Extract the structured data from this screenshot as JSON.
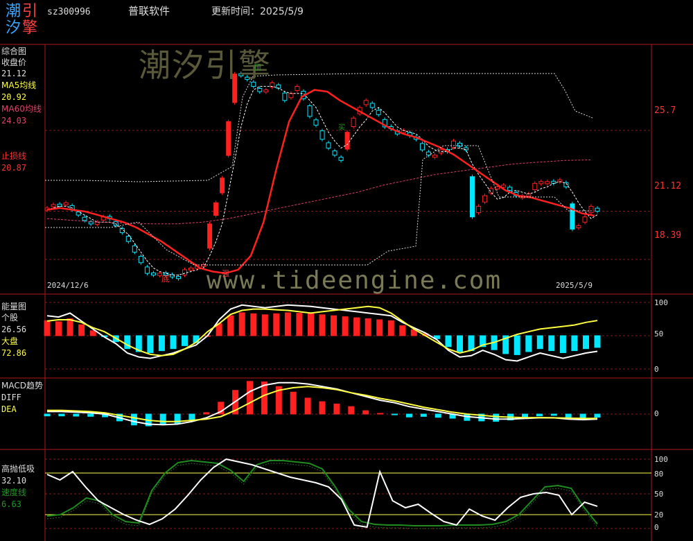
{
  "header": {
    "logo_chars": [
      "潮",
      "引",
      "汐",
      "擎"
    ],
    "code": "sz300996",
    "software": "普联软件",
    "update_label": "更新时间：2025/5/9"
  },
  "colors": {
    "up": "#ff2020",
    "down": "#00e8ff",
    "ma5": "#ffffff",
    "ma60": "#e0406a",
    "red_line": "#ff2020",
    "yellow": "#ffff40",
    "green": "#1e8c1e",
    "grid": "#a01010",
    "watermark": "#6a6a48"
  },
  "watermark": {
    "title": "潮汐引擎",
    "url": "www.tideengine.com"
  },
  "panels": {
    "main": {
      "title": "综合图",
      "close_label": "收盘价",
      "close_value": "21.12",
      "ma5_label": "MA5均线",
      "ma5_value": "20.92",
      "ma60_label": "MA60均线",
      "ma60_value": "24.03",
      "stop_label": "止损线",
      "stop_value": "20.87",
      "axis_labels": [
        "25.7",
        "21.12",
        "18.39"
      ],
      "date_start": "2024/12/6",
      "date_end": "2025/5/9",
      "annot_bottom": "底",
      "annot_strong": "强",
      "annot_top": "顶",
      "annot_buy": "买"
    },
    "energy": {
      "title": "能量图",
      "stock_label": "个股",
      "stock_value": "26.56",
      "market_label": "大盘",
      "market_value": "72.86",
      "axis_labels": [
        "100",
        "50",
        "0"
      ]
    },
    "macd": {
      "title": "MACD趋势",
      "diff_label": "DIFF",
      "dea_label": "DEA",
      "axis_labels": [
        "0"
      ]
    },
    "hilo": {
      "title": "高抛低吸",
      "value": "32.10",
      "speed_label": "速度线",
      "speed_value": "6.63",
      "axis_labels": [
        "100",
        "80",
        "50",
        "20",
        "0"
      ]
    }
  },
  "chart_data": [
    {
      "type": "candlestick",
      "title": "综合图",
      "x": [
        "2024/12/6",
        "2025/5/9"
      ],
      "ylim": [
        16.5,
        30.5
      ],
      "yticks": [
        25.7,
        21.12,
        18.39
      ],
      "series": [
        {
          "name": "收盘价",
          "values": [
            21.3,
            21.5,
            21.4,
            21.6,
            21.2,
            20.9,
            20.6,
            20.4,
            20.5,
            20.8,
            20.7,
            20.3,
            19.9,
            19.4,
            18.8,
            18.2,
            17.6,
            17.5,
            17.6,
            17.5,
            17.4,
            17.3,
            17.8,
            17.9,
            18.0,
            18.1,
            20.4,
            21.6,
            23.0,
            26.2,
            28.9,
            28.8,
            28.6,
            28.2,
            27.9,
            28.0,
            28.4,
            28.1,
            27.4,
            27.8,
            28.2,
            27.5,
            26.5,
            26.0,
            25.2,
            24.7,
            24.3,
            24.0,
            25.6,
            26.4,
            27.0,
            27.4,
            27.0,
            26.6,
            25.9,
            25.8,
            25.5,
            25.7,
            25.4,
            25.2,
            24.6,
            24.3,
            24.3,
            24.6,
            24.5,
            25.1,
            24.8,
            24.6,
            20.8,
            21.4,
            22.0,
            22.4,
            22.5,
            22.6,
            22.3,
            22.0,
            22.0,
            22.1,
            22.7,
            22.8,
            22.8,
            22.7,
            22.9,
            22.5,
            20.1,
            20.3,
            20.8,
            21.4,
            21.12
          ]
        },
        {
          "name": "MA5均线",
          "values": [
            21.2,
            21.3,
            21.4,
            21.4,
            21.3,
            21.1,
            20.9,
            20.7,
            20.5,
            20.5,
            20.5,
            20.4,
            20.1,
            19.8,
            19.3,
            18.8,
            18.3,
            17.9,
            17.7,
            17.6,
            17.5,
            17.5,
            17.6,
            17.7,
            17.8,
            17.9,
            18.6,
            19.4,
            20.4,
            22.2,
            24.0,
            25.9,
            27.2,
            28.0,
            28.2,
            28.2,
            28.2,
            28.1,
            27.9,
            27.8,
            27.8,
            27.8,
            27.4,
            27.0,
            26.3,
            25.6,
            25.1,
            24.7,
            24.9,
            25.4,
            25.9,
            26.3,
            26.8,
            27.0,
            26.7,
            26.3,
            25.9,
            25.7,
            25.6,
            25.5,
            25.2,
            24.8,
            24.6,
            24.5,
            24.5,
            24.7,
            24.7,
            24.6,
            23.8,
            23.2,
            22.7,
            22.2,
            21.8,
            21.9,
            22.2,
            22.3,
            22.2,
            22.1,
            22.2,
            22.4,
            22.5,
            22.7,
            22.8,
            22.7,
            22.2,
            21.6,
            21.1,
            20.7,
            20.92
          ]
        },
        {
          "name": "MA60均线",
          "values": [
            20.7,
            20.6,
            20.5,
            20.45,
            20.4,
            20.4,
            20.5,
            20.7,
            21.0,
            21.3,
            21.6,
            21.9,
            22.2,
            22.6,
            22.9,
            23.2,
            23.4,
            23.6,
            23.8,
            23.9,
            24.0,
            24.03
          ]
        },
        {
          "name": "止损线",
          "values": [
            21.2,
            21.3,
            21.2,
            21.1,
            20.9,
            20.7,
            20.5,
            20.2,
            19.8,
            19.4,
            18.9,
            18.4,
            17.9,
            17.7,
            17.6,
            17.8,
            18.6,
            20.5,
            23.5,
            26.2,
            27.6,
            28.0,
            27.9,
            27.4,
            27.0,
            26.6,
            26.2,
            25.8,
            25.5,
            25.3,
            25.0,
            24.7,
            24.3,
            23.8,
            23.3,
            22.8,
            22.3,
            22.0,
            21.9,
            21.7,
            21.5,
            21.3,
            21.0,
            20.87
          ]
        }
      ]
    },
    {
      "type": "bar",
      "title": "能量图",
      "ylim": [
        0,
        100
      ],
      "yticks": [
        100,
        50,
        0
      ],
      "series": [
        {
          "name": "个股",
          "values": [
            80,
            78,
            84,
            72,
            60,
            48,
            38,
            24,
            18,
            16,
            20,
            24,
            30,
            36,
            50,
            74,
            90,
            96,
            94,
            92,
            94,
            96,
            95,
            94,
            92,
            90,
            88,
            86,
            84,
            82,
            80,
            70,
            62,
            54,
            44,
            28,
            18,
            20,
            28,
            22,
            14,
            12,
            18,
            24,
            20,
            16,
            20,
            24,
            26.56
          ]
        },
        {
          "name": "大盘",
          "values": [
            72,
            74,
            74,
            70,
            62,
            56,
            46,
            36,
            28,
            22,
            20,
            22,
            30,
            40,
            56,
            68,
            82,
            88,
            90,
            90,
            89,
            88,
            86,
            84,
            86,
            88,
            90,
            92,
            94,
            92,
            84,
            72,
            60,
            50,
            40,
            30,
            24,
            28,
            36,
            40,
            46,
            52,
            56,
            60,
            62,
            64,
            66,
            70,
            72.86
          ]
        }
      ]
    },
    {
      "type": "line",
      "title": "MACD趋势",
      "series": [
        {
          "name": "DIFF",
          "values": [
            0.2,
            0.2,
            0.15,
            0.1,
            0.0,
            -0.3,
            -0.6,
            -0.8,
            -0.85,
            -0.8,
            -0.6,
            -0.3,
            0.2,
            1.0,
            1.8,
            2.3,
            2.5,
            2.5,
            2.4,
            2.2,
            2.0,
            1.7,
            1.4,
            1.1,
            0.9,
            0.6,
            0.4,
            0.2,
            0.0,
            -0.2,
            -0.3,
            -0.4,
            -0.4,
            -0.35,
            -0.3,
            -0.3,
            -0.4,
            -0.45,
            -0.4
          ]
        },
        {
          "name": "DEA",
          "values": [
            0.3,
            0.3,
            0.25,
            0.2,
            0.1,
            -0.1,
            -0.3,
            -0.5,
            -0.6,
            -0.6,
            -0.5,
            -0.4,
            -0.2,
            0.3,
            0.9,
            1.5,
            1.9,
            2.1,
            2.2,
            2.1,
            1.95,
            1.7,
            1.5,
            1.25,
            1.05,
            0.8,
            0.55,
            0.35,
            0.15,
            0.0,
            -0.1,
            -0.2,
            -0.25,
            -0.28,
            -0.28,
            -0.3,
            -0.32,
            -0.35,
            -0.35
          ]
        }
      ]
    },
    {
      "type": "line",
      "title": "高抛低吸",
      "ylim": [
        0,
        100
      ],
      "yticks": [
        100,
        80,
        50,
        20,
        0
      ],
      "series": [
        {
          "name": "高抛低吸",
          "values": [
            78,
            70,
            82,
            60,
            40,
            30,
            20,
            12,
            6,
            14,
            28,
            48,
            70,
            88,
            100,
            96,
            92,
            86,
            80,
            74,
            70,
            66,
            60,
            42,
            5,
            2,
            82,
            40,
            30,
            35,
            22,
            10,
            5,
            28,
            18,
            12,
            30,
            45,
            50,
            52,
            48,
            20,
            38,
            32.1
          ]
        },
        {
          "name": "速度线",
          "values": [
            18,
            20,
            30,
            44,
            40,
            20,
            10,
            8,
            55,
            80,
            95,
            98,
            96,
            94,
            84,
            68,
            92,
            98,
            98,
            96,
            94,
            86,
            60,
            28,
            10,
            6,
            5,
            5,
            4,
            4,
            4,
            5,
            5,
            5,
            6,
            10,
            20,
            40,
            60,
            62,
            58,
            30,
            6.63
          ]
        }
      ]
    }
  ]
}
